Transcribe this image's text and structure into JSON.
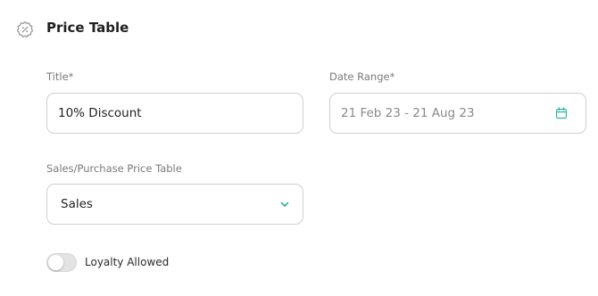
{
  "header": {
    "title": "Price Table",
    "icon": "discount-badge-icon"
  },
  "form": {
    "title_field": {
      "label": "Title*",
      "value": "10% Discount"
    },
    "date_range_field": {
      "label": "Date Range*",
      "value": "21 Feb 23 - 21 Aug 23",
      "icon": "calendar-icon"
    },
    "table_type_field": {
      "label": "Sales/Purchase Price Table",
      "selected": "Sales",
      "icon": "chevron-down-icon"
    },
    "loyalty_toggle": {
      "label": "Loyalty Allowed",
      "enabled": false
    }
  },
  "colors": {
    "accent": "#2bb5a0",
    "border": "#cfcfcf",
    "label": "#7a7a7a",
    "icon_gray": "#9a9a9a"
  }
}
